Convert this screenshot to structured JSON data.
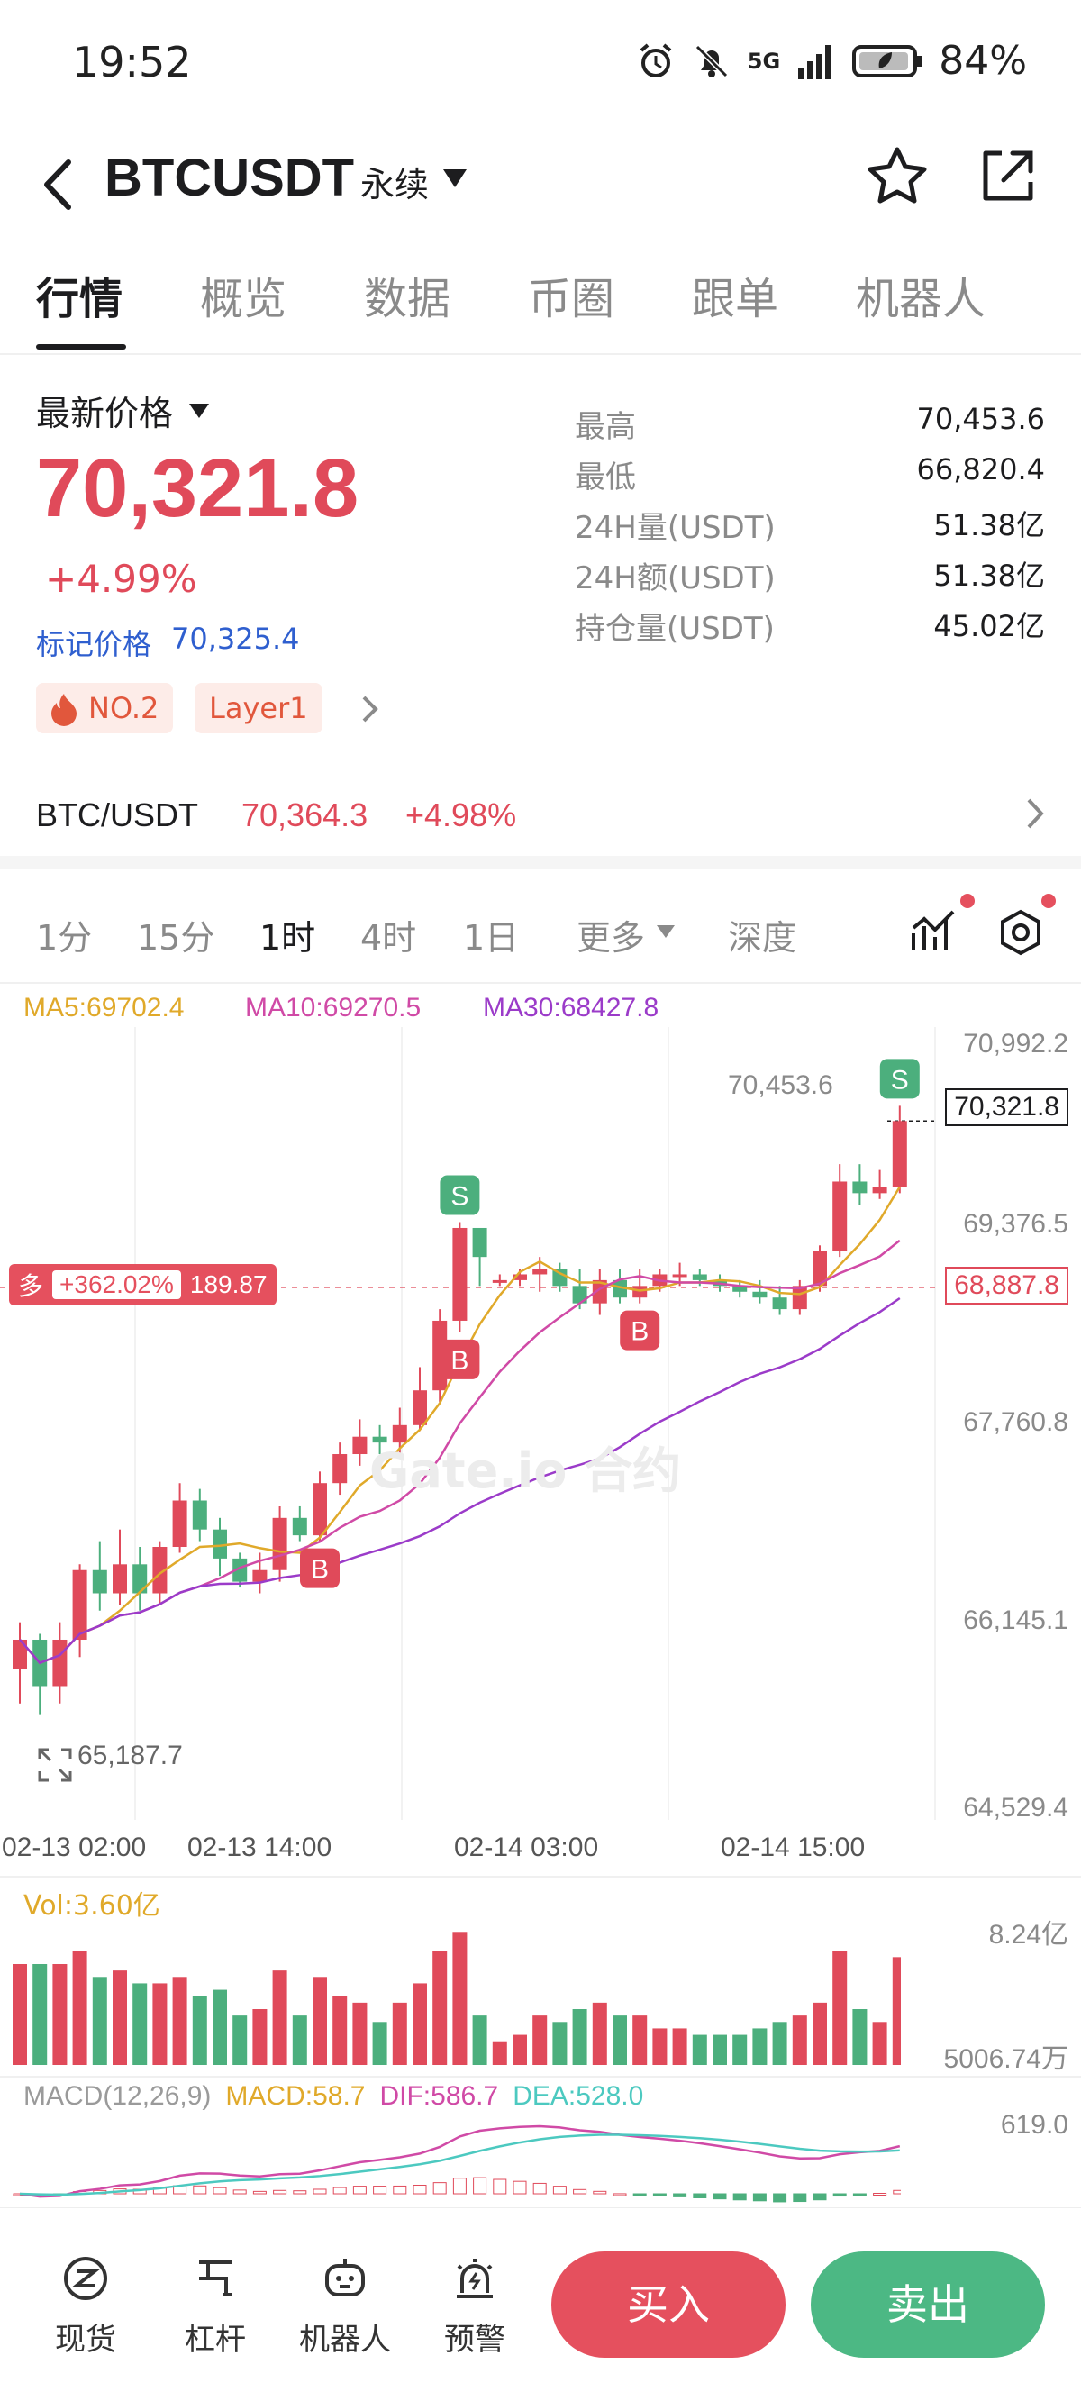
{
  "status_bar": {
    "time": "19:52",
    "network": "5G",
    "battery": "84%"
  },
  "header": {
    "title": "BTCUSDT",
    "subtitle": "永续"
  },
  "tabs": [
    "行情",
    "概览",
    "数据",
    "币圈",
    "跟单",
    "机器人"
  ],
  "price": {
    "label": "最新价格",
    "last": "70,321.8",
    "change": "+4.99%",
    "mark_label": "标记价格",
    "mark_value": "70,325.4"
  },
  "stats": [
    {
      "label": "最高",
      "value": "70,453.6"
    },
    {
      "label": "最低",
      "value": "66,820.4"
    },
    {
      "label": "24H量(USDT)",
      "value": "51.38亿"
    },
    {
      "label": "24H额(USDT)",
      "value": "51.38亿"
    },
    {
      "label": "持仓量(USDT)",
      "value": "45.02亿"
    }
  ],
  "tags": {
    "rank": "NO.2",
    "category": "Layer1"
  },
  "spot": {
    "pair": "BTC/USDT",
    "price": "70,364.3",
    "change": "+4.98%"
  },
  "timeframes": [
    "1分",
    "15分",
    "1时",
    "4时",
    "1日",
    "更多",
    "深度"
  ],
  "ma": {
    "ma5": "MA5:69702.4",
    "ma10": "MA10:69270.5",
    "ma30": "MA30:68427.8"
  },
  "chart_data": {
    "type": "candlestick",
    "y_axis": [
      "70,992.2",
      "69,376.5",
      "67,760.8",
      "66,145.1",
      "64,529.4"
    ],
    "x_axis": [
      "02-13 02:00",
      "02-13 14:00",
      "02-14 03:00",
      "02-14 15:00"
    ],
    "high_marker": "70,453.6",
    "low_marker": "65,187.7",
    "last_price_tag": "70,321.8",
    "entry_price_tag": "68,887.8",
    "position": {
      "side": "多",
      "pnl_pct": "+362.02%",
      "pnl": "189.87"
    },
    "markers": [
      "B",
      "B",
      "B",
      "S",
      "S"
    ],
    "candles": [
      [
        65600,
        65850,
        65300,
        66000
      ],
      [
        65850,
        65450,
        65200,
        65900
      ],
      [
        65450,
        65850,
        65300,
        66000
      ],
      [
        65850,
        66450,
        65700,
        66500
      ],
      [
        66450,
        66250,
        66100,
        66700
      ],
      [
        66250,
        66500,
        66150,
        66800
      ],
      [
        66500,
        66250,
        66100,
        66650
      ],
      [
        66250,
        66650,
        66150,
        66700
      ],
      [
        66650,
        67050,
        66600,
        67200
      ],
      [
        67050,
        66800,
        66700,
        67150
      ],
      [
        66800,
        66550,
        66400,
        66900
      ],
      [
        66550,
        66350,
        66300,
        66600
      ],
      [
        66350,
        66450,
        66250,
        66600
      ],
      [
        66450,
        66900,
        66350,
        67000
      ],
      [
        66900,
        66750,
        66700,
        67000
      ],
      [
        66750,
        67200,
        66700,
        67300
      ],
      [
        67200,
        67450,
        67100,
        67550
      ],
      [
        67450,
        67600,
        67350,
        67750
      ],
      [
        67600,
        67550,
        67450,
        67700
      ],
      [
        67550,
        67700,
        67450,
        67850
      ],
      [
        67700,
        68000,
        67650,
        68200
      ],
      [
        68000,
        68600,
        67900,
        68700
      ],
      [
        68600,
        69400,
        68500,
        69450
      ],
      [
        69400,
        69150,
        68900,
        69200
      ],
      [
        68950,
        68950,
        68900,
        69000
      ],
      [
        68950,
        69000,
        68900,
        69050
      ],
      [
        69000,
        69050,
        68850,
        69150
      ],
      [
        69050,
        68900,
        68850,
        69100
      ],
      [
        68900,
        68750,
        68700,
        69050
      ],
      [
        68750,
        68950,
        68650,
        69050
      ],
      [
        68950,
        68800,
        68750,
        69050
      ],
      [
        68800,
        68900,
        68750,
        69050
      ],
      [
        68900,
        69000,
        68850,
        69050
      ],
      [
        69000,
        69000,
        68900,
        69100
      ],
      [
        69000,
        68950,
        68900,
        69050
      ],
      [
        68950,
        68900,
        68850,
        69000
      ],
      [
        68900,
        68850,
        68800,
        68950
      ],
      [
        68850,
        68800,
        68750,
        68950
      ],
      [
        68800,
        68700,
        68650,
        68900
      ],
      [
        68700,
        68900,
        68650,
        68950
      ],
      [
        68900,
        69200,
        68850,
        69250
      ],
      [
        69200,
        69800,
        69150,
        69950
      ],
      [
        69800,
        69700,
        69600,
        69950
      ],
      [
        69700,
        69750,
        69650,
        69900
      ],
      [
        69750,
        70321.8,
        69700,
        70453.6
      ]
    ]
  },
  "volume": {
    "label": "Vol:3.60亿",
    "max": "8.24亿",
    "min": "5006.74万"
  },
  "macd": {
    "label": "MACD(12,26,9)",
    "macd": "MACD:58.7",
    "dif": "DIF:586.7",
    "dea": "DEA:528.0",
    "axis": "619.0"
  },
  "watermark": "Gate.io 合约",
  "bottom_nav": [
    "现货",
    "杠杆",
    "机器人",
    "预警"
  ],
  "actions": {
    "buy": "买入",
    "sell": "卖出"
  },
  "colors": {
    "up": "#e04a5a",
    "down": "#4caf7d",
    "buy": "#e5505e",
    "sell": "#4cb884"
  }
}
